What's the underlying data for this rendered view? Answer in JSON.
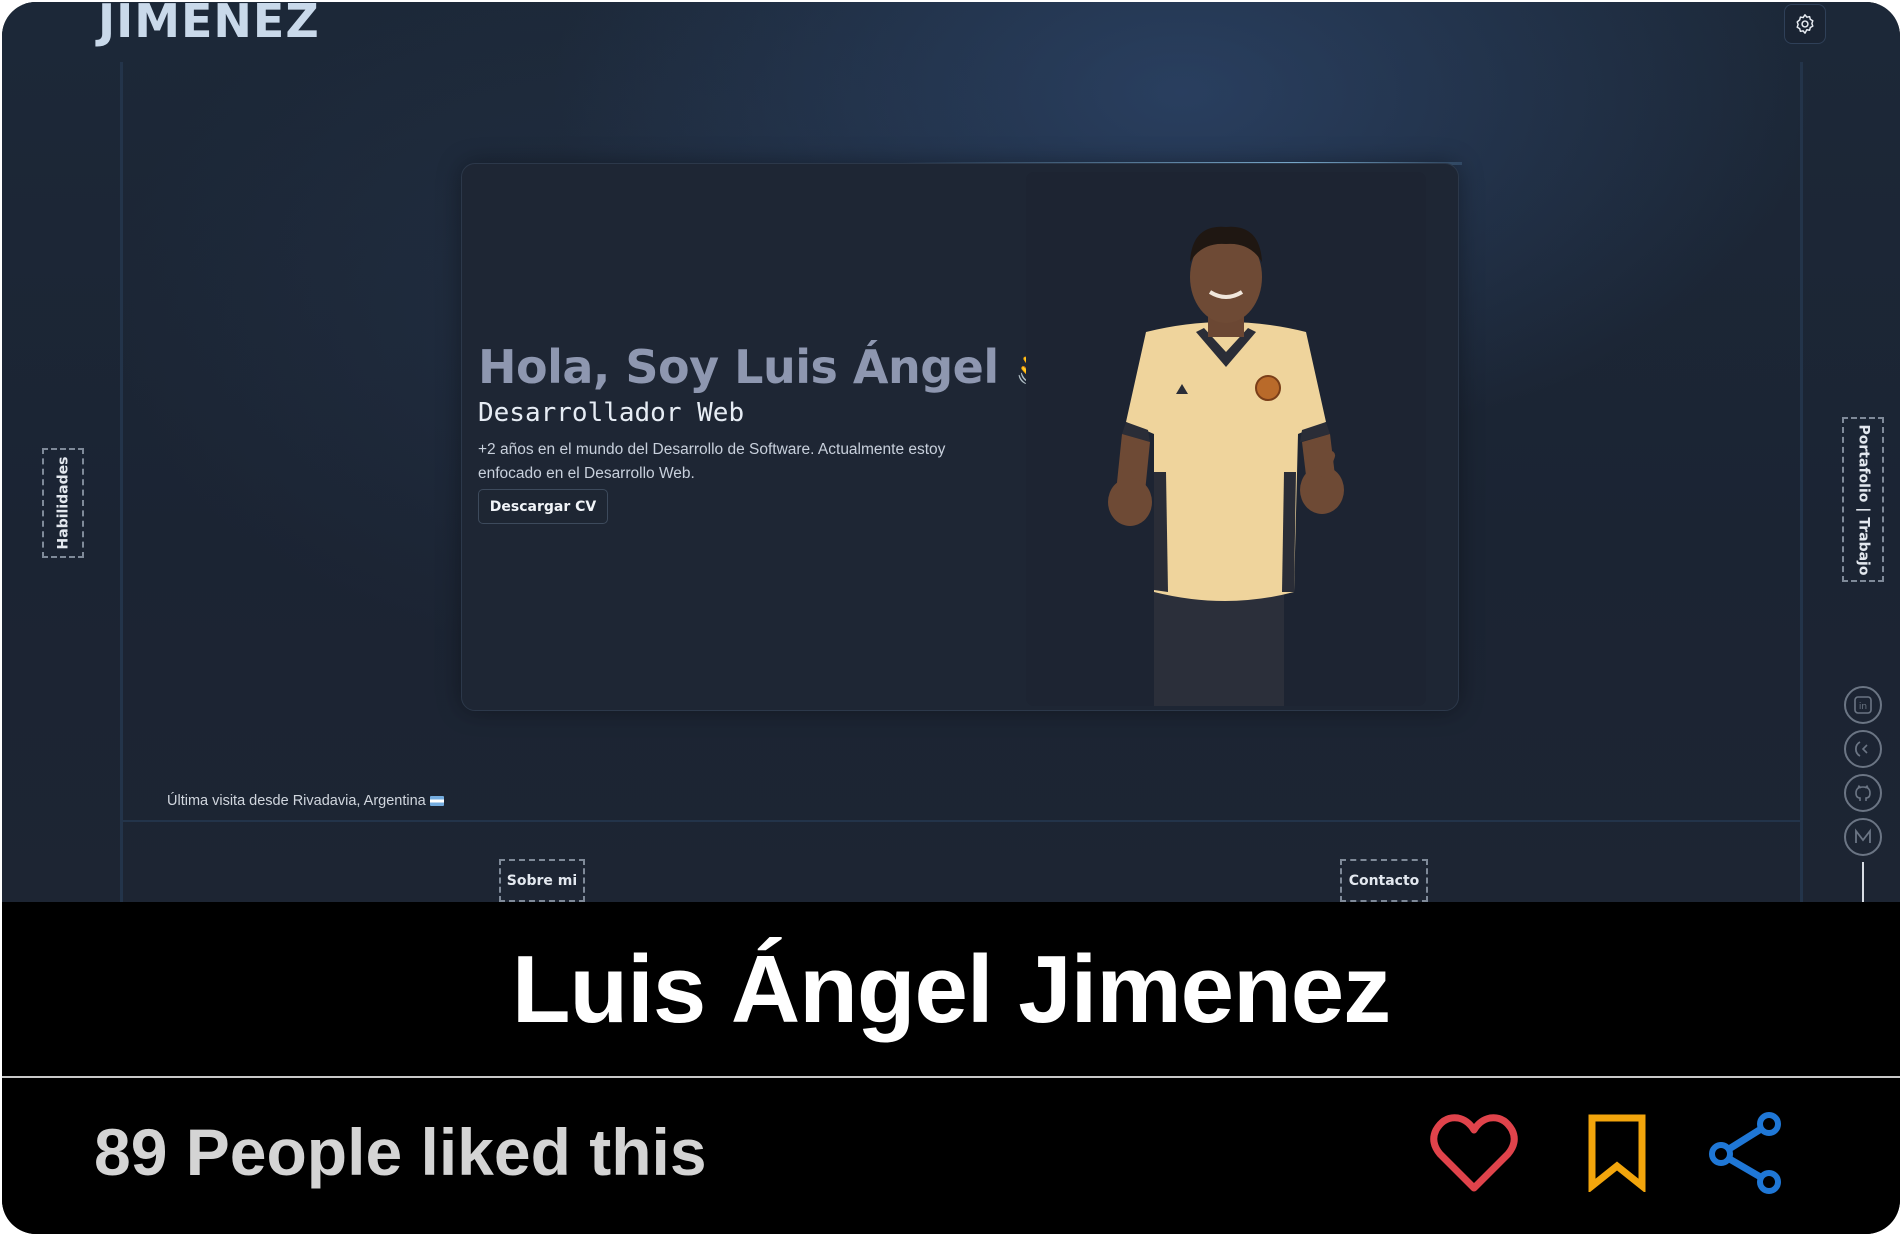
{
  "screenshot": {
    "brand": "JIMENEZ",
    "hero": {
      "greeting": "Hola, Soy Luis Ángel",
      "greeting_emoji": "👋",
      "role": "Desarrollador Web",
      "description": "+2 años en el mundo del Desarrollo de Software. Actualmente estoy enfocado en el Desarrollo Web.",
      "cv_button": "Descargar CV"
    },
    "side_tabs": {
      "left": "Habilidades",
      "right": "Portafolio | Trabajo"
    },
    "bottom_tabs": {
      "about": "Sobre mi",
      "contact": "Contacto"
    },
    "last_visit": "Última visita desde Rivadavia, Argentina",
    "social_icons": [
      "linkedin-icon",
      "dev-icon",
      "github-icon",
      "medium-icon"
    ],
    "settings_icon": "gear-icon"
  },
  "caption": {
    "title": "Luis Ángel Jimenez",
    "likes": "89 People liked this"
  },
  "colors": {
    "heart": "#e0434b",
    "bookmark": "#f2a50c",
    "share": "#1f77d6"
  }
}
